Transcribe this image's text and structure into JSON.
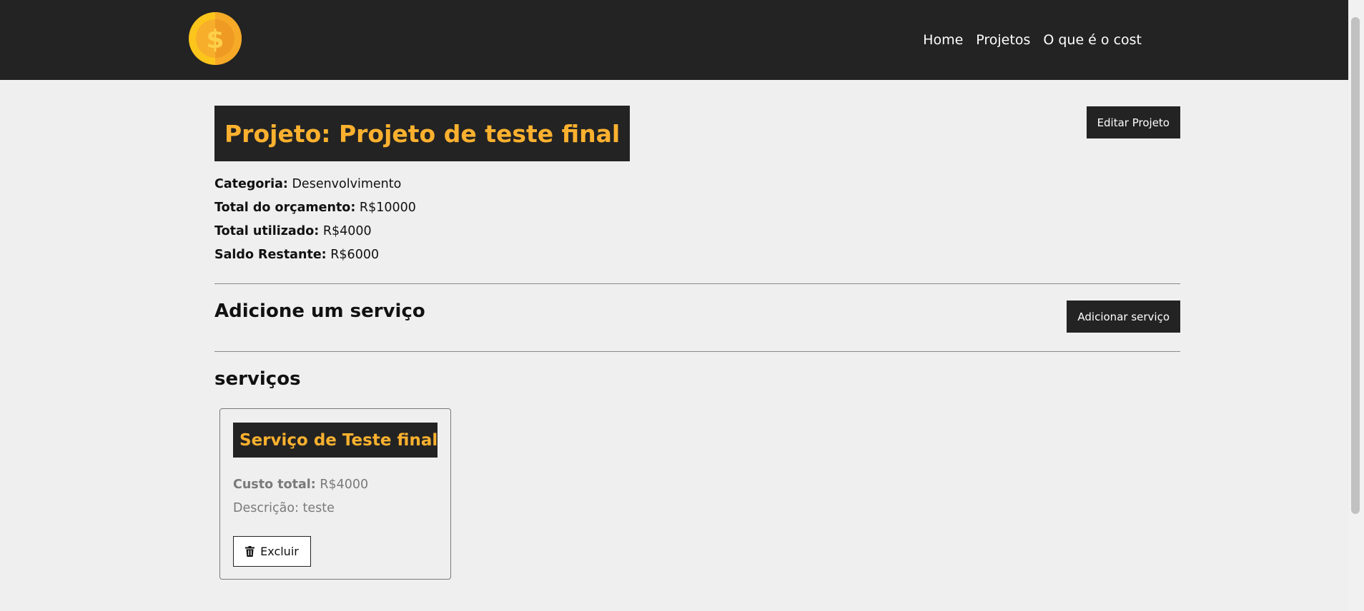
{
  "nav": {
    "logo_icon": "coin-dollar-icon",
    "links": [
      "Home",
      "Projetos",
      "O que é o cost"
    ]
  },
  "project": {
    "title": "Projeto: Projeto de teste final",
    "edit_label": "Editar Projeto",
    "info": [
      {
        "label": "Categoria:",
        "value": "Desenvolvimento"
      },
      {
        "label": "Total do orçamento:",
        "value": "R$10000"
      },
      {
        "label": "Total utilizado:",
        "value": "R$4000"
      },
      {
        "label": "Saldo Restante:",
        "value": "R$6000"
      }
    ]
  },
  "add_service": {
    "title": "Adicione um serviço",
    "button_label": "Adicionar serviço"
  },
  "services": {
    "title": "serviços",
    "items": [
      {
        "name": "Serviço de Teste final",
        "cost_label": "Custo total:",
        "cost_value": "R$4000",
        "description": "Descrição: teste",
        "delete_label": "Excluir",
        "delete_icon": "trash-icon"
      }
    ]
  },
  "colors": {
    "navbar_bg": "#232323",
    "accent_yellow": "#fbb12f",
    "page_bg": "#efefef"
  }
}
